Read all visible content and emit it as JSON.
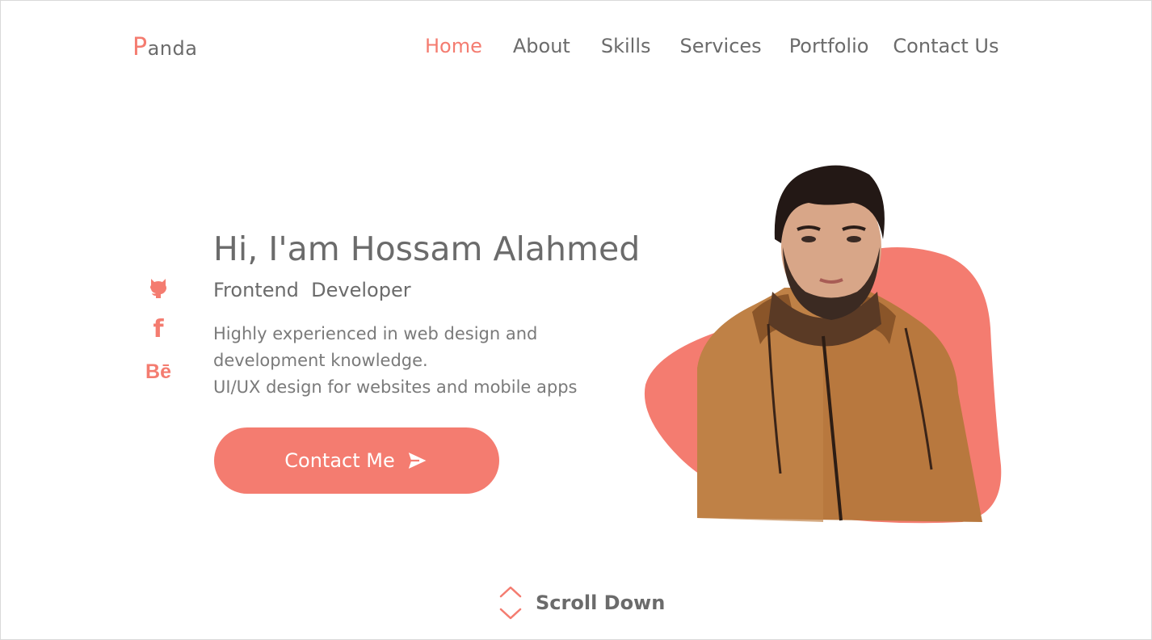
{
  "brand": {
    "initial": "P",
    "rest": "anda"
  },
  "nav": {
    "items": [
      {
        "label": "Home",
        "active": true
      },
      {
        "label": "About",
        "active": false
      },
      {
        "label": "Skills",
        "active": false
      },
      {
        "label": "Services",
        "active": false
      },
      {
        "label": "Portfolio",
        "active": false
      },
      {
        "label": "Contact Us",
        "active": false
      }
    ]
  },
  "socials": [
    {
      "icon": "github-icon"
    },
    {
      "icon": "facebook-icon",
      "glyph": "f"
    },
    {
      "icon": "behance-icon",
      "glyph": "Bē"
    }
  ],
  "hero": {
    "title": "Hi, I'am Hossam Alahmed",
    "subtitle": "Frontend  Developer",
    "description_lines": [
      "Highly experienced in web design and",
      "development knowledge.",
      "UI/UX design for websites and mobile apps"
    ],
    "cta_label": "Contact Me",
    "cta_icon": "send-icon"
  },
  "scroll": {
    "label": "Scroll Down",
    "icon": "scroll-arrows-icon"
  },
  "colors": {
    "accent": "#f47c70",
    "text": "#6b6b6b",
    "background": "#ffffff",
    "jacket": "#b8783e"
  }
}
